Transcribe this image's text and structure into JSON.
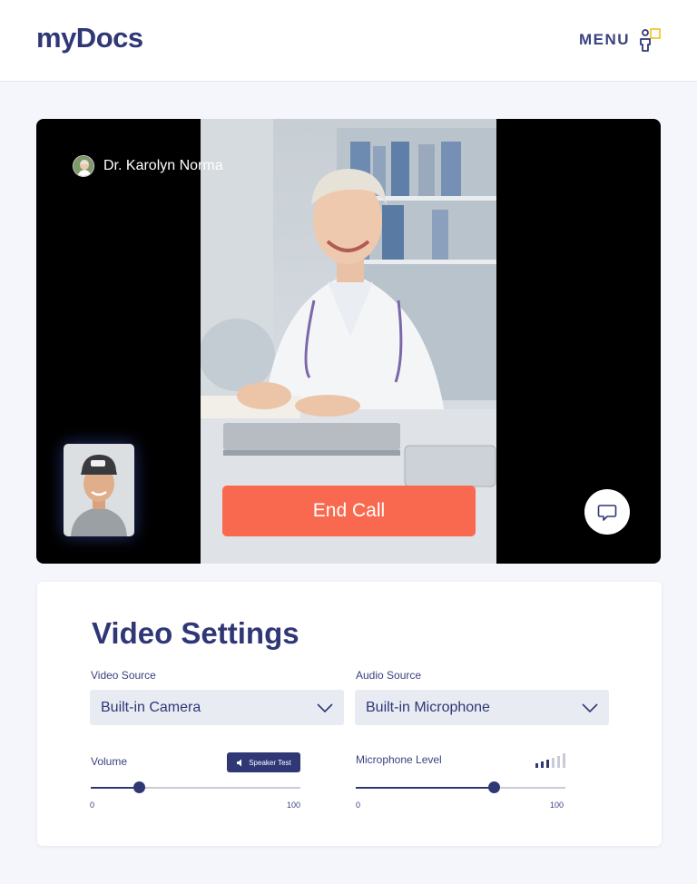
{
  "header": {
    "logo": "myDocs",
    "menu_label": "MENU",
    "menu_icon": "person-chat-icon"
  },
  "call": {
    "doctor_name": "Dr. Karolyn Norma",
    "end_call_label": "End Call",
    "chat_icon": "chat-bubble-icon",
    "colors": {
      "end_call": "#f9694f",
      "background": "#000000"
    }
  },
  "settings": {
    "title": "Video Settings",
    "video_source": {
      "label": "Video Source",
      "value": "Built-in Camera"
    },
    "audio_source": {
      "label": "Audio Source",
      "value": "Built-in Microphone"
    },
    "volume": {
      "label": "Volume",
      "min": "0",
      "max": "100",
      "value": 23,
      "speaker_test_label": "Speaker Test"
    },
    "mic_level": {
      "label": "Microphone Level",
      "min": "0",
      "max": "100",
      "value": 66,
      "meter_bars_active": 3,
      "meter_bars_total": 6
    }
  },
  "colors": {
    "primary": "#2f3775",
    "accent": "#f9694f",
    "page_bg": "#f5f6fb"
  }
}
